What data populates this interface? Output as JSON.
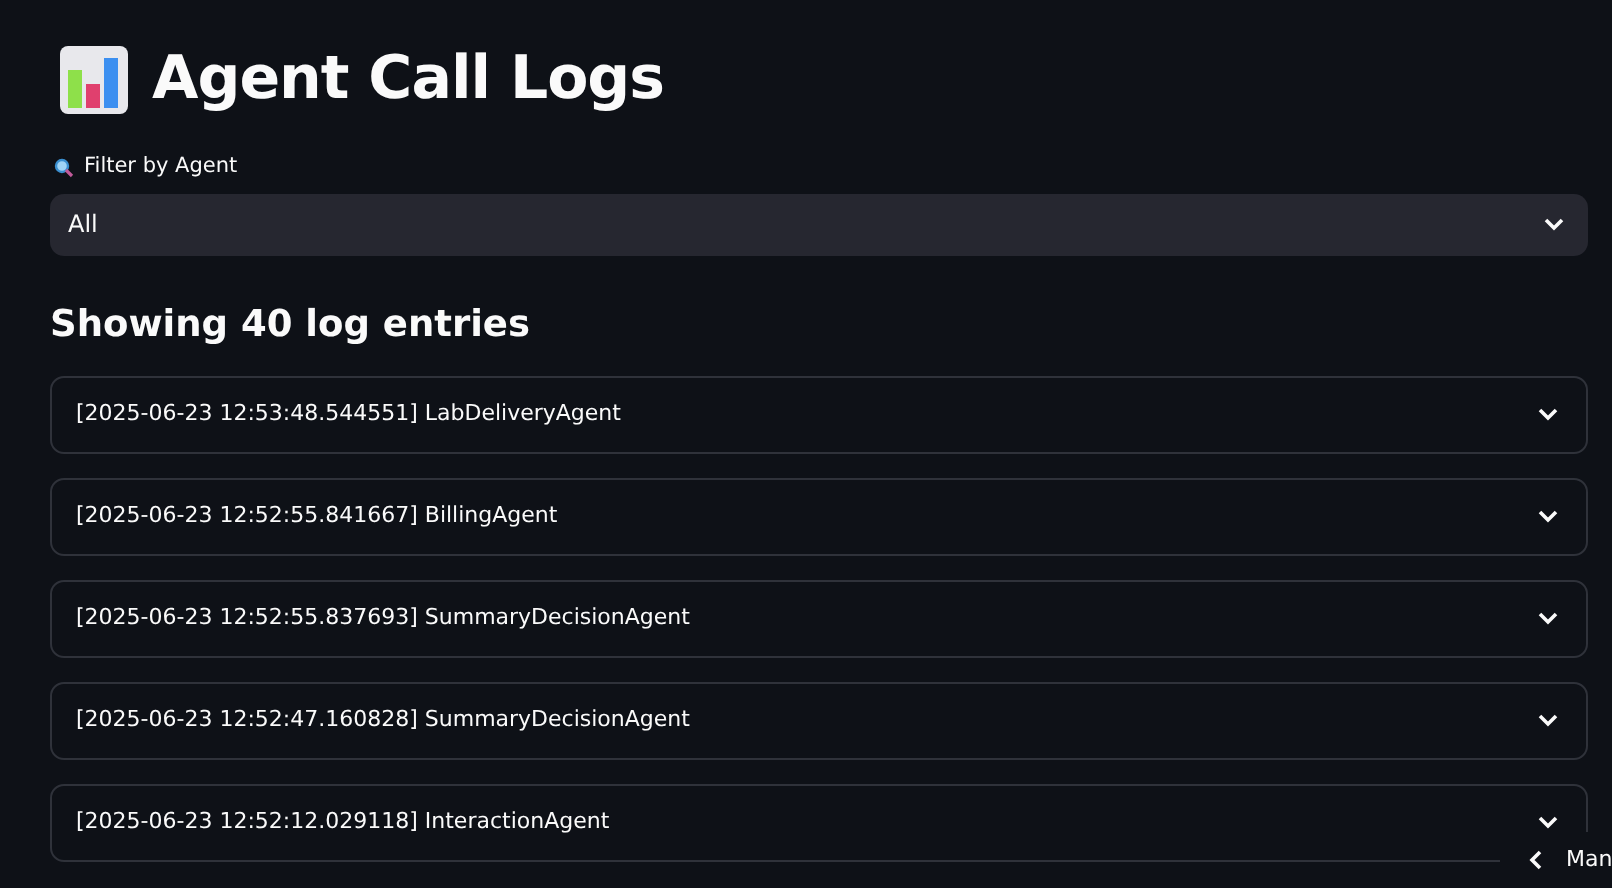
{
  "title": "Agent Call Logs",
  "filter": {
    "label": "Filter by Agent",
    "value": "All"
  },
  "heading": "Showing 40 log entries",
  "entries": [
    {
      "label": "[2025-06-23 12:53:48.544551] LabDeliveryAgent",
      "expanded": false
    },
    {
      "label": "[2025-06-23 12:52:55.841667] BillingAgent",
      "expanded": false
    },
    {
      "label": "[2025-06-23 12:52:55.837693] SummaryDecisionAgent",
      "expanded": false
    },
    {
      "label": "[2025-06-23 12:52:47.160828] SummaryDecisionAgent",
      "expanded": false
    },
    {
      "label": "[2025-06-23 12:52:12.029118] InteractionAgent",
      "expanded": false
    }
  ],
  "manage_button": "Man"
}
